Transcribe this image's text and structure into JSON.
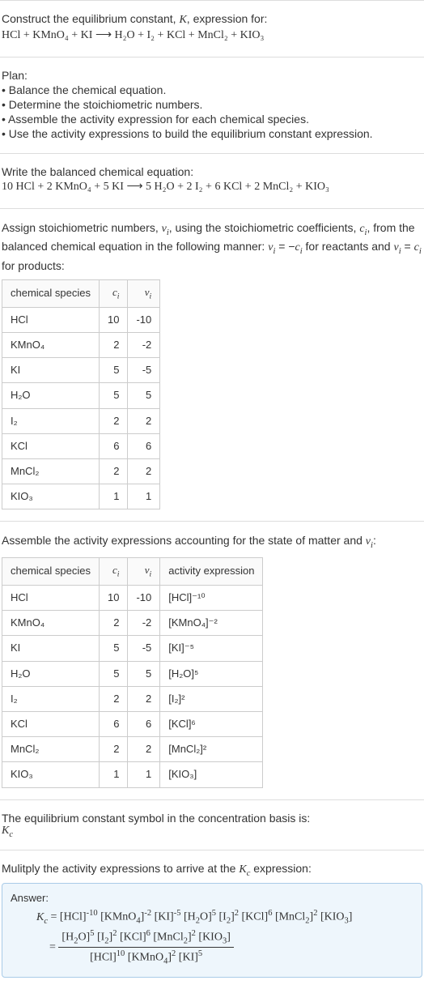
{
  "intro": {
    "line1": "Construct the equilibrium constant, K, expression for:",
    "equation": "HCl + KMnO₄ + KI ⟶ H₂O + I₂ + KCl + MnCl₂ + KIO₃"
  },
  "plan": {
    "title": "Plan:",
    "items": [
      "• Balance the chemical equation.",
      "• Determine the stoichiometric numbers.",
      "• Assemble the activity expression for each chemical species.",
      "• Use the activity expressions to build the equilibrium constant expression."
    ]
  },
  "balanced": {
    "title": "Write the balanced chemical equation:",
    "equation": "10 HCl + 2 KMnO₄ + 5 KI ⟶ 5 H₂O + 2 I₂ + 6 KCl + 2 MnCl₂ + KIO₃"
  },
  "stoich": {
    "intro_a": "Assign stoichiometric numbers, νᵢ, using the stoichiometric coefficients, cᵢ, from the balanced chemical equation in the following manner: νᵢ = −cᵢ for reactants and νᵢ = cᵢ for products:",
    "headers": [
      "chemical species",
      "cᵢ",
      "νᵢ"
    ],
    "rows": [
      {
        "sp": "HCl",
        "c": "10",
        "v": "-10"
      },
      {
        "sp": "KMnO₄",
        "c": "2",
        "v": "-2"
      },
      {
        "sp": "KI",
        "c": "5",
        "v": "-5"
      },
      {
        "sp": "H₂O",
        "c": "5",
        "v": "5"
      },
      {
        "sp": "I₂",
        "c": "2",
        "v": "2"
      },
      {
        "sp": "KCl",
        "c": "6",
        "v": "6"
      },
      {
        "sp": "MnCl₂",
        "c": "2",
        "v": "2"
      },
      {
        "sp": "KIO₃",
        "c": "1",
        "v": "1"
      }
    ]
  },
  "activity": {
    "intro": "Assemble the activity expressions accounting for the state of matter and νᵢ:",
    "headers": [
      "chemical species",
      "cᵢ",
      "νᵢ",
      "activity expression"
    ],
    "rows": [
      {
        "sp": "HCl",
        "c": "10",
        "v": "-10",
        "a": "[HCl]⁻¹⁰"
      },
      {
        "sp": "KMnO₄",
        "c": "2",
        "v": "-2",
        "a": "[KMnO₄]⁻²"
      },
      {
        "sp": "KI",
        "c": "5",
        "v": "-5",
        "a": "[KI]⁻⁵"
      },
      {
        "sp": "H₂O",
        "c": "5",
        "v": "5",
        "a": "[H₂O]⁵"
      },
      {
        "sp": "I₂",
        "c": "2",
        "v": "2",
        "a": "[I₂]²"
      },
      {
        "sp": "KCl",
        "c": "6",
        "v": "6",
        "a": "[KCl]⁶"
      },
      {
        "sp": "MnCl₂",
        "c": "2",
        "v": "2",
        "a": "[MnCl₂]²"
      },
      {
        "sp": "KIO₃",
        "c": "1",
        "v": "1",
        "a": "[KIO₃]"
      }
    ]
  },
  "symbol": {
    "line1": "The equilibrium constant symbol in the concentration basis is:",
    "kc": "K꜀"
  },
  "multiply": {
    "line": "Mulitply the activity expressions to arrive at the K꜀ expression:"
  },
  "answer": {
    "label": "Answer:",
    "line1": "K꜀ = [HCl]⁻¹⁰ [KMnO₄]⁻² [KI]⁻⁵ [H₂O]⁵ [I₂]² [KCl]⁶ [MnCl₂]² [KIO₃]",
    "frac_num": "[H₂O]⁵ [I₂]² [KCl]⁶ [MnCl₂]² [KIO₃]",
    "frac_den": "[HCl]¹⁰ [KMnO₄]² [KI]⁵",
    "eq_prefix": "= "
  }
}
